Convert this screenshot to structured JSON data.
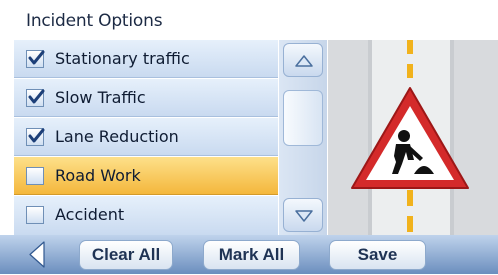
{
  "header": {
    "title": "Incident Options"
  },
  "incidents": [
    {
      "label": "Stationary traffic",
      "checked": true
    },
    {
      "label": "Slow Traffic",
      "checked": true
    },
    {
      "label": "Lane Reduction",
      "checked": true
    },
    {
      "label": "Road Work",
      "checked": false,
      "selected": true
    },
    {
      "label": "Accident",
      "checked": false
    }
  ],
  "scrollbar": {
    "up_icon": "triangle-up-icon",
    "down_icon": "triangle-down-icon"
  },
  "preview": {
    "icon": "road-work-warning-sign-icon"
  },
  "toolbar": {
    "back_icon": "back-arrow-icon",
    "clear_all": "Clear All",
    "mark_all": "Mark All",
    "save": "Save"
  },
  "colors": {
    "selected_row": "#f4b73c",
    "row": "#d6e4f5",
    "toolbar": "#6b8ebe",
    "sign_border": "#d42a2a"
  }
}
